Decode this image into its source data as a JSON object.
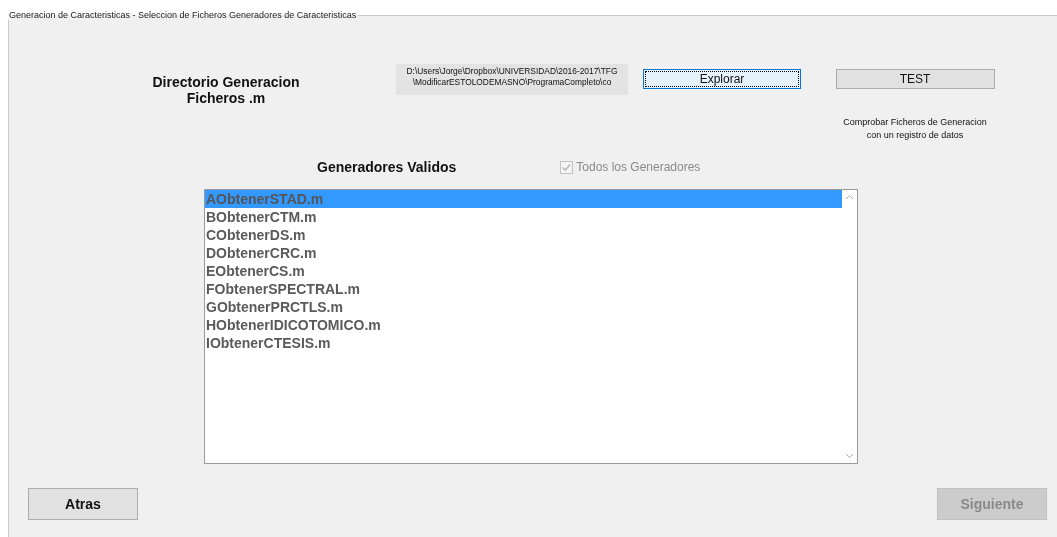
{
  "panel": {
    "title": "Generacion de Caracteristicas - Seleccion de Ficheros Generadores de Caracteristicas"
  },
  "directory": {
    "label": "Directorio Generacion Ficheros .m",
    "path": "D:\\Users\\Jorge\\Dropbox\\UNIVERSIDAD\\2016-2017\\TFG\\ModificarESTOLODEMASNO\\ProgramaCompleto\\co"
  },
  "explore_button": {
    "label": "Explorar",
    "focused": true
  },
  "test_button": {
    "label": "TEST"
  },
  "test_note": "Comprobar Ficheros de Generacion con un registro de datos",
  "generators": {
    "title": "Generadores Validos",
    "all_checkbox": {
      "label": "Todos los Generadores",
      "checked": true,
      "disabled": true
    },
    "items": [
      {
        "label": "AObtenerSTAD.m",
        "selected": true
      },
      {
        "label": "BObtenerCTM.m",
        "selected": false
      },
      {
        "label": "CObtenerDS.m",
        "selected": false
      },
      {
        "label": "DObtenerCRC.m",
        "selected": false
      },
      {
        "label": "EObtenerCS.m",
        "selected": false
      },
      {
        "label": "FObtenerSPECTRAL.m",
        "selected": false
      },
      {
        "label": "GObtenerPRCTLS.m",
        "selected": false
      },
      {
        "label": "HObtenerIDICOTOMICO.m",
        "selected": false
      },
      {
        "label": "IObtenerCTESIS.m",
        "selected": false
      }
    ]
  },
  "back_button": {
    "label": "Atras",
    "disabled": false
  },
  "next_button": {
    "label": "Siguiente",
    "disabled": true
  }
}
